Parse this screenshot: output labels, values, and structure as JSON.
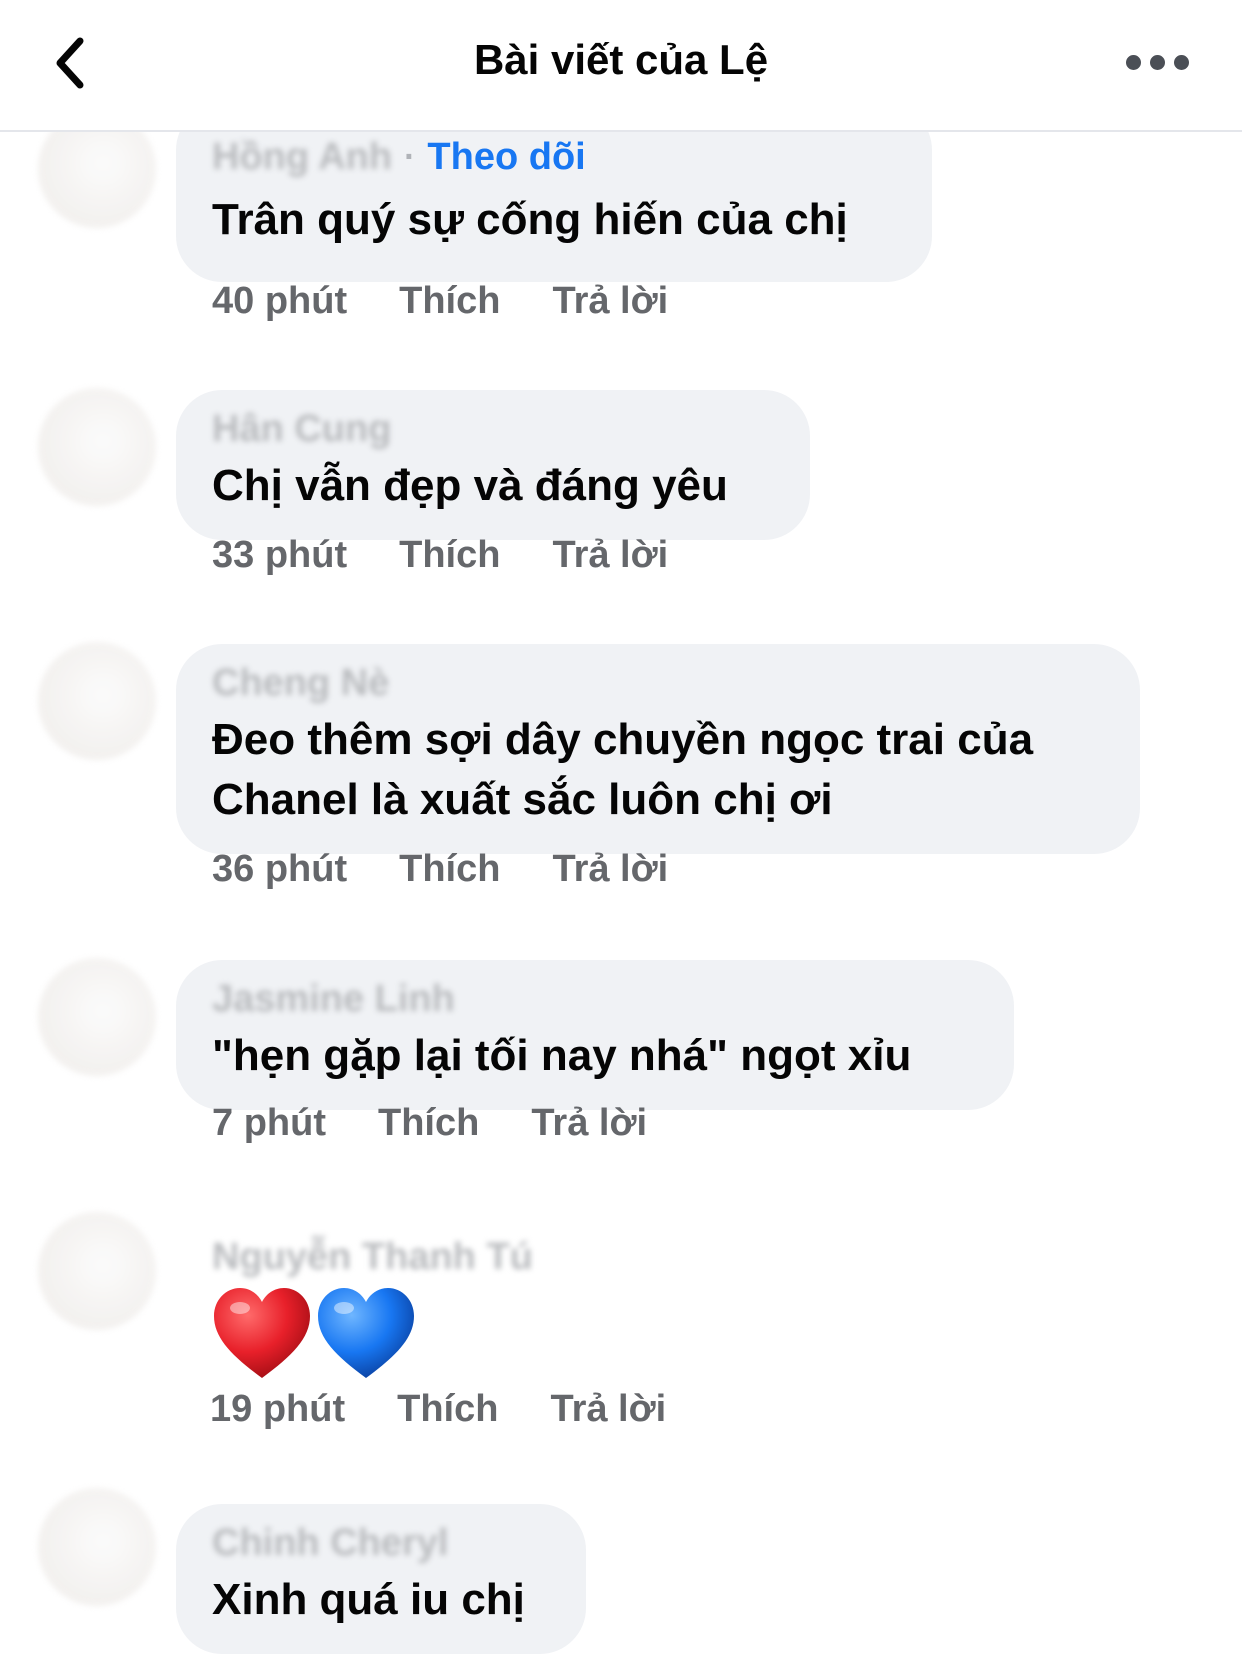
{
  "header": {
    "title": "Bài viết của Lệ"
  },
  "comments": [
    {
      "author": "Hồng Anh",
      "follow_label": "Theo dõi",
      "text": "Trân quý sự cống hiến của chị",
      "time": "40 phút",
      "like_label": "Thích",
      "reply_label": "Trả lời"
    },
    {
      "author": "Hân Cung",
      "text": "Chị vẫn đẹp và đáng yêu",
      "time": "33 phút",
      "like_label": "Thích",
      "reply_label": "Trả lời"
    },
    {
      "author": "Cheng Nè",
      "text_line1": "Đeo thêm sợi dây chuyền ngọc trai của",
      "text_line2": "Chanel là xuất sắc luôn chị ơi",
      "time": "36 phút",
      "like_label": "Thích",
      "reply_label": "Trả lời"
    },
    {
      "author": "Jasmine Linh",
      "text": "\"hẹn gặp lại tối nay nhá\" ngọt xỉu",
      "time": "7 phút",
      "like_label": "Thích",
      "reply_label": "Trả lời"
    },
    {
      "author": "Nguyễn Thanh Tú",
      "emoji": [
        "red-heart",
        "blue-heart"
      ],
      "time": "19 phút",
      "like_label": "Thích",
      "reply_label": "Trả lời"
    },
    {
      "author": "Chinh Cheryl",
      "text": "Xinh quá iu chị"
    }
  ],
  "colors": {
    "follow": "#1877f2",
    "bubble": "#f0f2f5",
    "meta": "#65676b",
    "heart_red": "#e8202a",
    "heart_blue": "#1877f2"
  }
}
